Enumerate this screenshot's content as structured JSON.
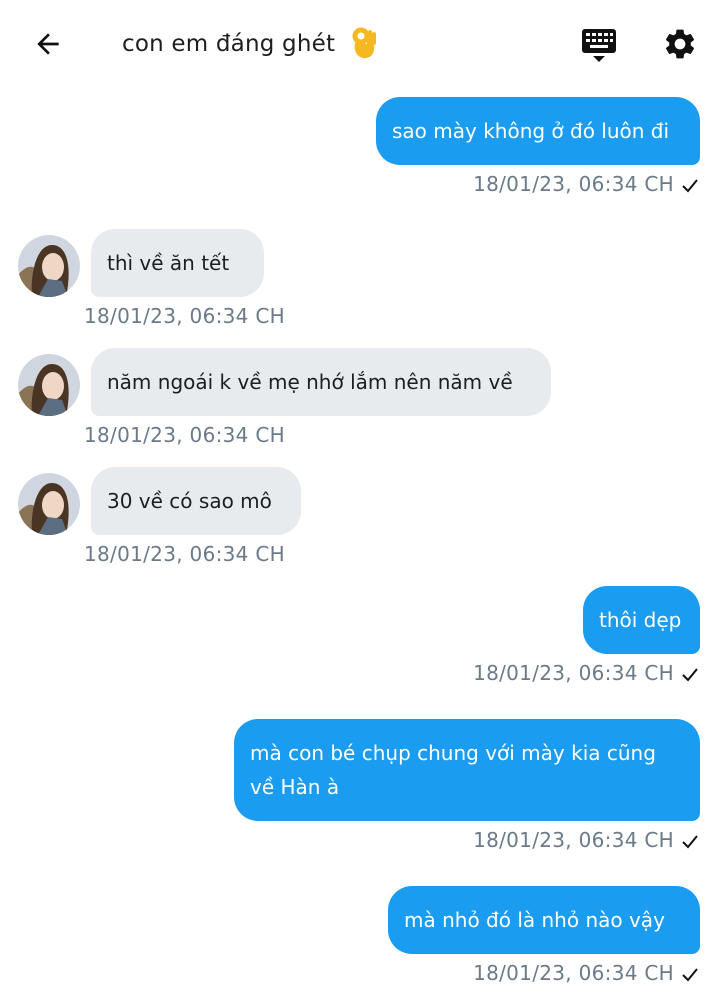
{
  "header": {
    "title": "con em đáng ghét",
    "title_emoji": "ok-hand-emoji",
    "back_icon": "arrow-left-icon",
    "keyboard_icon": "keyboard-icon",
    "settings_icon": "gear-icon"
  },
  "colors": {
    "outgoing_bubble": "#1a9cf0",
    "incoming_bubble": "#e8ebee",
    "timestamp": "#6b7a89"
  },
  "messages": [
    {
      "direction": "out",
      "text": "sao mày không ở đó luôn đi",
      "timestamp": "18/01/23,  06:34 CH"
    },
    {
      "direction": "in",
      "text": "thì về ăn tết",
      "timestamp": "18/01/23,  06:34 CH"
    },
    {
      "direction": "in",
      "text": "năm ngoái k về mẹ nhớ lắm nên năm về",
      "timestamp": "18/01/23,  06:34 CH"
    },
    {
      "direction": "in",
      "text": "30 về có sao mô",
      "timestamp": "18/01/23,  06:34 CH"
    },
    {
      "direction": "out",
      "text": "thôi dẹp",
      "timestamp": "18/01/23,  06:34 CH"
    },
    {
      "direction": "out",
      "text_line1": "mà con bé chụp chung với mày kia cũng",
      "text_line2": "về Hàn à",
      "timestamp": "18/01/23,  06:34 CH"
    },
    {
      "direction": "out",
      "text": "mà nhỏ đó là nhỏ nào vậy",
      "timestamp": "18/01/23,  06:34 CH"
    }
  ]
}
